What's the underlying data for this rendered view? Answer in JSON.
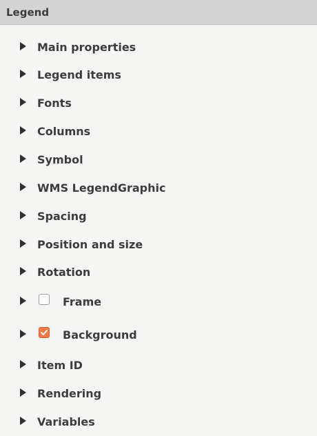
{
  "header": {
    "title": "Legend"
  },
  "groups": [
    {
      "label": "Main properties",
      "icon": "chevron-right-icon"
    },
    {
      "label": "Legend items",
      "icon": "chevron-right-icon"
    },
    {
      "label": "Fonts",
      "icon": "chevron-right-icon"
    },
    {
      "label": "Columns",
      "icon": "chevron-right-icon"
    },
    {
      "label": "Symbol",
      "icon": "chevron-right-icon"
    },
    {
      "label": "WMS LegendGraphic",
      "icon": "chevron-right-icon"
    },
    {
      "label": "Spacing",
      "icon": "chevron-right-icon"
    },
    {
      "label": "Position and size",
      "icon": "chevron-right-icon"
    },
    {
      "label": "Rotation",
      "icon": "chevron-right-icon"
    },
    {
      "label": "Frame",
      "icon": "chevron-right-icon",
      "checkbox": false
    },
    {
      "label": "Background",
      "icon": "chevron-right-icon",
      "checkbox": true
    },
    {
      "label": "Item ID",
      "icon": "chevron-right-icon"
    },
    {
      "label": "Rendering",
      "icon": "chevron-right-icon"
    },
    {
      "label": "Variables",
      "icon": "chevron-right-icon"
    }
  ],
  "colors": {
    "header_bg": "#d4d4d4",
    "panel_bg": "#f5f5f4",
    "checkbox_checked": "#f07746",
    "text": "#3c3c3c"
  }
}
